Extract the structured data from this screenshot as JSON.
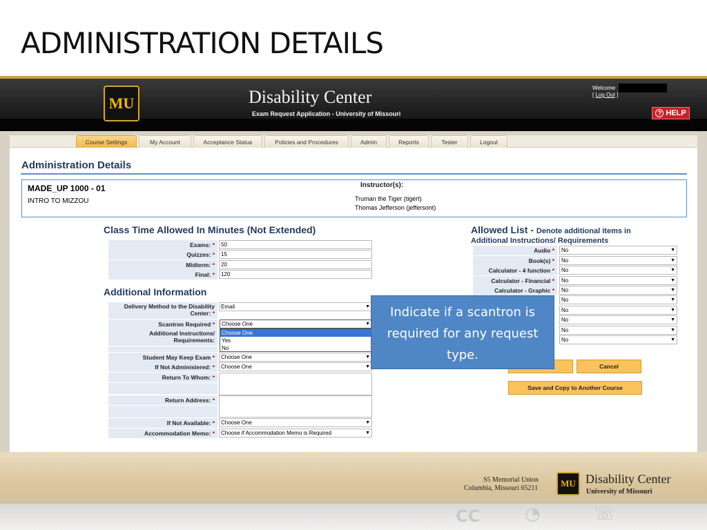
{
  "slide": {
    "title": "ADMINISTRATION DETAILS"
  },
  "header": {
    "logo_text": "MU",
    "title": "Disability Center",
    "subtitle": "Exam Request Application - University of Missouri",
    "welcome": "Welcome",
    "logout_prefix": "[",
    "logout_label": "Log Out",
    "logout_suffix": "]",
    "help_label": "HELP"
  },
  "nav": {
    "tabs": [
      {
        "label": "Course Settings",
        "active": true
      },
      {
        "label": "My Account"
      },
      {
        "label": "Acceptance Status"
      },
      {
        "label": "Policies and Procedures"
      },
      {
        "label": "Admin"
      },
      {
        "label": "Reports"
      },
      {
        "label": "Tester"
      },
      {
        "label": "Logout"
      }
    ]
  },
  "page": {
    "heading": "Administration Details"
  },
  "course": {
    "code": "MADE_UP 1000 - 01",
    "name": "INTRO TO MIZZOU",
    "instructors_label": "Instructor(s):",
    "instructors": [
      "Truman the Tiger (tigert)",
      "Thomas Jefferson (jeffersont)"
    ]
  },
  "class_time": {
    "heading": "Class Time Allowed In Minutes (Not Extended)",
    "rows": [
      {
        "label": "Exams:",
        "value": "50"
      },
      {
        "label": "Quizzes:",
        "value": "15"
      },
      {
        "label": "Midterm:",
        "value": "20"
      },
      {
        "label": "Final:",
        "value": "120"
      }
    ]
  },
  "additional": {
    "heading": "Additional Information",
    "delivery_label_1": "Delivery Method to the Disability",
    "delivery_label_2": "Center:",
    "delivery_value": "Email",
    "scantron_label": "Scantron Required",
    "scantron_value": "Choose One",
    "scantron_options": [
      "Choose One",
      "Yes",
      "No"
    ],
    "instructions_label_1": "Additional Instructions/",
    "instructions_label_2": "Requirements:",
    "keep_exam_label": "Student May Keep Exam",
    "keep_exam_value": "Choose One",
    "not_administered_label": "If Not Administered:",
    "not_administered_value": "Choose One",
    "return_whom_label": "Return To Whom:",
    "return_address_label": "Return Address:",
    "not_available_label": "If Not Available:",
    "not_available_value": "Choose One",
    "memo_label": "Accommodation Memo:",
    "memo_value": "Choose if Accommodation Memo is Required",
    "required_mark": "*"
  },
  "allowed_list": {
    "heading": "Allowed List -",
    "note_1": "Denote additional items in",
    "note_2": "Additional Instructions/ Requirements",
    "rows": [
      {
        "label": "Audio",
        "value": "No"
      },
      {
        "label": "Book(s)",
        "value": "No"
      },
      {
        "label": "Calculator - 4 function",
        "value": "No"
      },
      {
        "label": "Calculator - Financial",
        "value": "No"
      },
      {
        "label": "Calculator - Graphic",
        "value": "No"
      },
      {
        "label": "",
        "value": "No"
      },
      {
        "label": "",
        "value": "No"
      },
      {
        "label": "",
        "value": "No"
      },
      {
        "label": "",
        "value": "No"
      },
      {
        "label": "",
        "value": "No"
      }
    ]
  },
  "buttons": {
    "cancel": "Cancel",
    "save_copy": "Save and Copy to Another Course"
  },
  "callout": {
    "text": "Indicate if a scantron is required for any request type."
  },
  "footer": {
    "address_1": "S5 Memorial Union",
    "address_2": "Columbia, Missouri 65211",
    "logo_text": "MU",
    "title": "Disability Center",
    "subtitle": "University of Missouri",
    "icon_cc": "CC"
  },
  "colors": {
    "accent_gold": "#f2b705",
    "heading_blue": "#1f3a5f",
    "callout_blue": "#4f86c6",
    "button_orange": "#f9c25a"
  }
}
